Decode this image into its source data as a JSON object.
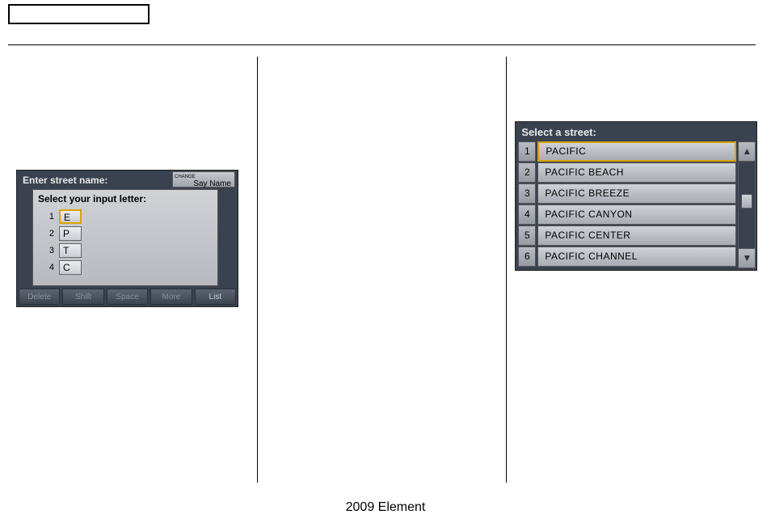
{
  "footer": "2009  Element",
  "screen1": {
    "title": "Enter street name:",
    "say_name_small": "CHANGE",
    "say_name": "Say Name",
    "popup_title": "Select your input letter:",
    "rows": [
      {
        "n": "1",
        "v": "E"
      },
      {
        "n": "2",
        "v": "P"
      },
      {
        "n": "3",
        "v": "T"
      },
      {
        "n": "4",
        "v": "C"
      }
    ],
    "buttons": {
      "delete": "Delete",
      "shift": "Shift",
      "space": "Space",
      "more": "More",
      "list": "List"
    }
  },
  "screen2": {
    "title": "Select a street:",
    "up": "▲",
    "down": "▼",
    "rows": [
      {
        "n": "1",
        "v": "PACIFIC"
      },
      {
        "n": "2",
        "v": "PACIFIC BEACH"
      },
      {
        "n": "3",
        "v": "PACIFIC BREEZE"
      },
      {
        "n": "4",
        "v": "PACIFIC CANYON"
      },
      {
        "n": "5",
        "v": "PACIFIC CENTER"
      },
      {
        "n": "6",
        "v": "PACIFIC CHANNEL"
      }
    ]
  }
}
